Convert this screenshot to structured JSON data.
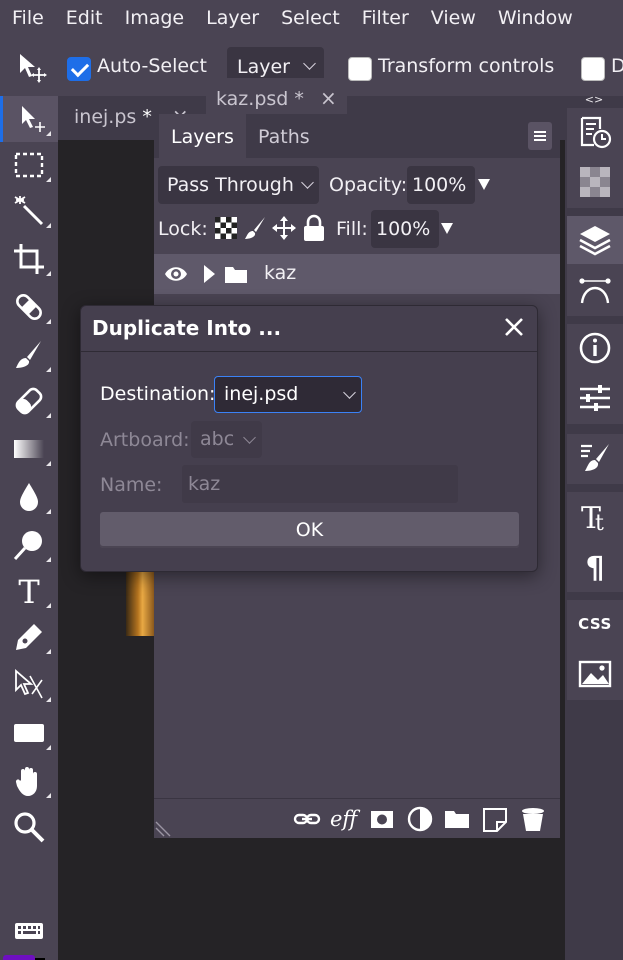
{
  "menu": [
    "File",
    "Edit",
    "Image",
    "Layer",
    "Select",
    "Filter",
    "View",
    "Window"
  ],
  "options": {
    "auto_select_label": "Auto-Select",
    "auto_select_checked": true,
    "target_select": "Layer",
    "transform_label": "Transform controls",
    "transform_checked": false,
    "cut_label": "D"
  },
  "tabs": [
    {
      "label": "inej.ps",
      "modified": "*",
      "close": "×"
    },
    {
      "label": "kaz.psd",
      "modified": "*",
      "close": "×"
    }
  ],
  "layers_panel": {
    "tabs": [
      "Layers",
      "Paths"
    ],
    "blend_mode": "Pass Through",
    "opacity_label": "Opacity:",
    "opacity_value": "100%",
    "lock_label": "Lock:",
    "fill_label": "Fill:",
    "fill_value": "100%",
    "layer_name": "kaz",
    "footer_eff": "eff"
  },
  "dialog": {
    "title": "Duplicate Into ...",
    "destination_label": "Destination:",
    "destination_value": "inej.psd",
    "artboard_label": "Artboard:",
    "artboard_value": "abc",
    "name_label": "Name:",
    "name_value": "kaz",
    "ok_label": "OK"
  },
  "right_panel": {
    "arrows": "<>",
    "css_label": "CSS"
  },
  "colors": {
    "accent": "#1e6ee8",
    "foreground": "#6e0fc0",
    "background": "#5e0fa0",
    "panel": "#4a4453"
  }
}
